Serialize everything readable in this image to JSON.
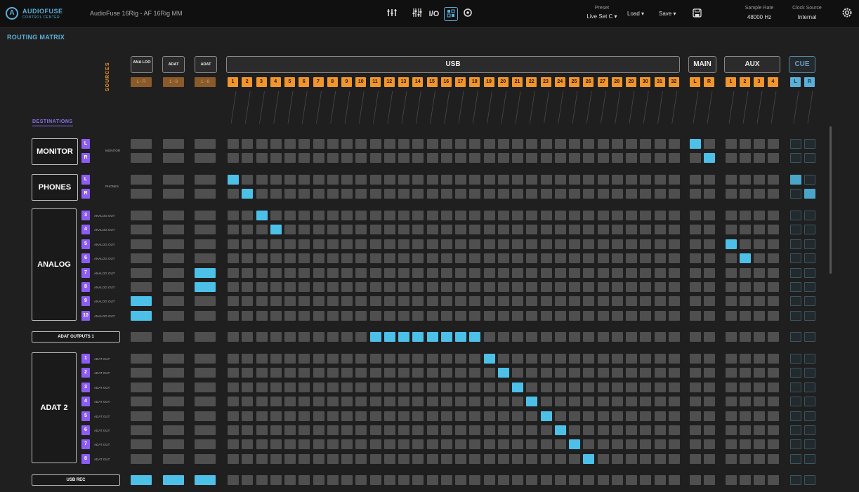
{
  "topbar": {
    "logo_mark": "A",
    "logo_text": "AUDIOFUSE",
    "logo_sub": "CONTROL CENTER",
    "device_name": "AudioFuse 16Rig - AF 16Rig MM",
    "icons": [
      "mixer-icon",
      "faders-icon",
      "io-icon",
      "matrix-icon",
      "settings-circle-icon"
    ],
    "preset_label": "Preset",
    "preset_value": "Live Set C ▾",
    "load_label": "Load ▾",
    "save_label": "Save ▾",
    "sample_rate_label": "Sample Rate",
    "sample_rate_value": "48000 Hz",
    "clock_source_label": "Clock Source",
    "clock_source_value": "Internal",
    "gear_icon": "gear-icon"
  },
  "matrix": {
    "title": "ROUTING MATRIX",
    "sources_label": "SOURCES",
    "destinations_label": "DESTINATIONS",
    "source_groups": {
      "ana_loo": "ANA\nLOO",
      "adat1": "ADAT",
      "adat2": "ADAT",
      "usb": "USB",
      "main": "MAIN",
      "aux": "AUX",
      "cue": "CUE"
    },
    "pair_labels": [
      "L - R",
      "1 - 8",
      "1 - 8"
    ],
    "usb_channels": [
      "1",
      "2",
      "3",
      "4",
      "5",
      "6",
      "7",
      "8",
      "9",
      "10",
      "11",
      "12",
      "13",
      "14",
      "15",
      "16",
      "17",
      "18",
      "19",
      "20",
      "21",
      "22",
      "23",
      "24",
      "25",
      "26",
      "27",
      "28",
      "29",
      "30",
      "31",
      "32"
    ],
    "main_channels": [
      "L",
      "R"
    ],
    "aux_channels": [
      "1",
      "2",
      "3",
      "4"
    ],
    "cue_channels": [
      "L",
      "R"
    ],
    "destinations": {
      "monitor": {
        "name": "MONITOR",
        "nums": [
          "L",
          "R"
        ],
        "label": "MONITOR"
      },
      "phones": {
        "name": "PHONES",
        "nums": [
          "L",
          "R"
        ],
        "label": "PHONES"
      },
      "analog": {
        "name": "ANALOG",
        "nums": [
          "3",
          "4",
          "5",
          "6",
          "7",
          "8",
          "9",
          "10"
        ],
        "label": "ANALOG OUT"
      },
      "adat_outputs_1": {
        "name": "ADAT OUTPUTS 1"
      },
      "adat2": {
        "name": "ADAT 2",
        "nums": [
          "1",
          "2",
          "3",
          "4",
          "5",
          "6",
          "7",
          "8"
        ],
        "label": "ADAT OUT"
      },
      "usb_rec": {
        "name": "USB REC"
      }
    }
  }
}
